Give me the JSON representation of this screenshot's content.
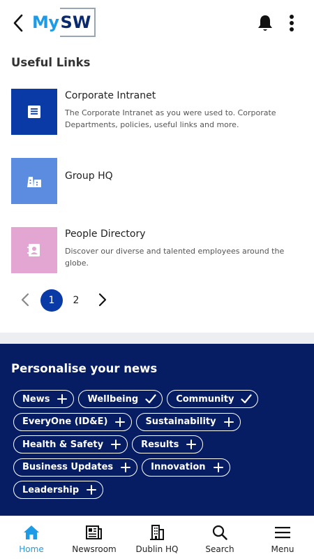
{
  "header": {
    "logo_my": "My",
    "logo_sw": "SW",
    "icons": [
      "back-arrow-icon",
      "bell-icon",
      "more-vertical-icon"
    ]
  },
  "useful_links": {
    "title": "Useful Links",
    "items": [
      {
        "title": "Corporate Intranet",
        "description": "The Corporate Intranet as you were used to. Corporate Departments, policies, useful links and more.",
        "color": "#0a3aa5",
        "icon": "document-icon"
      },
      {
        "title": "Group HQ",
        "description": "",
        "color": "#5b8ce0",
        "icon": "buildings-icon"
      },
      {
        "title": "People Directory",
        "description": "Discover our diverse and talented employees around the globe.",
        "color": "#e3a6d3",
        "icon": "contact-card-icon"
      }
    ],
    "pagination": {
      "pages": [
        "1",
        "2"
      ],
      "current": "1"
    }
  },
  "personalise": {
    "title": "Personalise your news",
    "rows": [
      [
        {
          "label": "News",
          "state": "add"
        },
        {
          "label": "Wellbeing",
          "state": "selected"
        },
        {
          "label": "Community",
          "state": "selected"
        }
      ],
      [
        {
          "label": "EveryOne (ID&E)",
          "state": "add"
        },
        {
          "label": "Sustainability",
          "state": "add"
        }
      ],
      [
        {
          "label": "Health & Safety",
          "state": "add"
        },
        {
          "label": "Results",
          "state": "add"
        }
      ],
      [
        {
          "label": "Business Updates",
          "state": "add"
        },
        {
          "label": "Innovation",
          "state": "add"
        }
      ],
      [
        {
          "label": "Leadership",
          "state": "add"
        }
      ]
    ]
  },
  "bottom_nav": {
    "items": [
      {
        "label": "Home",
        "icon": "home-icon",
        "active": true
      },
      {
        "label": "Newsroom",
        "icon": "newspaper-icon",
        "active": false
      },
      {
        "label": "Dublin HQ",
        "icon": "building-icon",
        "active": false
      },
      {
        "label": "Search",
        "icon": "search-icon",
        "active": false
      },
      {
        "label": "Menu",
        "icon": "menu-icon",
        "active": false
      }
    ]
  },
  "colors": {
    "brand_navy": "#061d63",
    "accent_blue": "#1e9be6",
    "active_page": "#0a3aa5"
  }
}
